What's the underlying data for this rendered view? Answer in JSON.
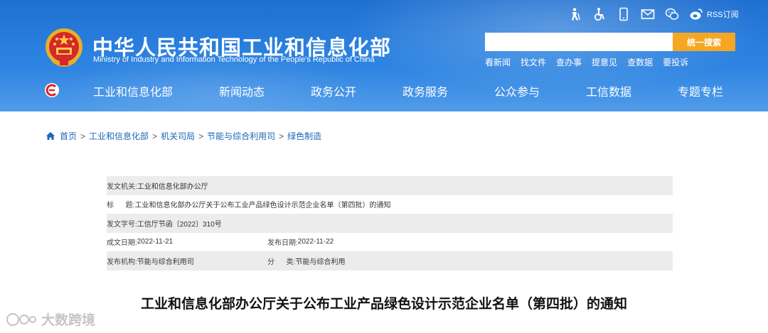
{
  "header": {
    "title": "中华人民共和国工业和信息化部",
    "subtitle": "Ministry of Industry and Information Technology of the People's Republic of China",
    "utility_icons": [
      "accessibility-elder-icon",
      "wheelchair-icon",
      "mobile-icon",
      "mail-icon",
      "wechat-icon",
      "weibo-icon"
    ],
    "rss_label": "RSS订阅",
    "search": {
      "value": "",
      "button_label": "统一搜索"
    },
    "quick_links": [
      "看新闻",
      "找文件",
      "查办事",
      "提意见",
      "查数据",
      "要投诉"
    ],
    "nav": [
      "工业和信息化部",
      "新闻动态",
      "政务公开",
      "政务服务",
      "公众参与",
      "工信数据",
      "专题专栏"
    ]
  },
  "breadcrumb": [
    "首页",
    "工业和信息化部",
    "机关司局",
    "节能与综合利用司",
    "绿色制造"
  ],
  "info": {
    "issuer_label": "发文机关:",
    "issuer": "工业和信息化部办公厅",
    "title_label": "标      题:",
    "title": "工业和信息化部办公厅关于公布工业产品绿色设计示范企业名单（第四批）的通知",
    "doc_no_label": "发文字号:",
    "doc_no": "工信厅节函〔2022〕310号",
    "date_label": "成文日期:",
    "date": "2022-11-21",
    "pub_date_label": "发布日期:",
    "pub_date": "2022-11-22",
    "org_label": "发布机构:",
    "org": "节能与综合利用司",
    "category_label": "分      类:",
    "category": "节能与综合利用"
  },
  "document_title": "工业和信息化部办公厅关于公布工业产品绿色设计示范企业名单（第四批）的通知",
  "watermark": "大数跨境",
  "colors": {
    "header_blue": "#2a80df",
    "search_button": "#f5a623",
    "link_blue": "#1a66b8",
    "row_shade": "#ececec"
  }
}
